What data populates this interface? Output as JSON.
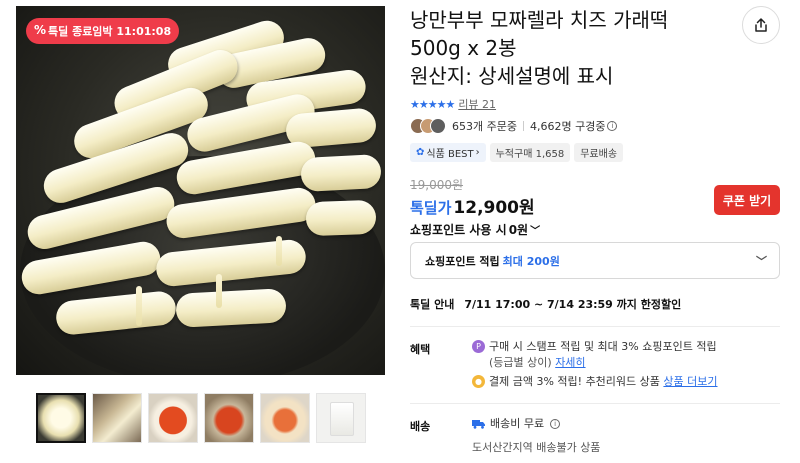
{
  "gallery": {
    "badge_text": "특딜 종료임박 11:01:08",
    "badge_icon": "percent-icon",
    "thumbnails": [
      "thumb-1",
      "thumb-2",
      "thumb-3",
      "thumb-4",
      "thumb-5",
      "thumb-6"
    ]
  },
  "product": {
    "title_line1": "낭만부부 모짜렐라 치즈 가래떡",
    "title_line2": "500g x 2봉",
    "title_line3": "원산지: 상세설명에 표시",
    "stars": "★★★★★",
    "review_label": "리뷰 21",
    "order_count": "653개 주문중",
    "view_count": "4,662명 구경중",
    "tags": {
      "best": "식품 BEST",
      "cumulative": "누적구매 1,658",
      "free_shipping": "무료배송"
    }
  },
  "price": {
    "original": "19,000원",
    "label": "톡딜가",
    "value": "12,900원",
    "coupon_button": "쿠폰 받기"
  },
  "points": {
    "use_label": "쇼핑포인트 사용 시",
    "use_value": "0원",
    "earn_label": "쇼핑포인트 적립",
    "earn_max": "최대 200원"
  },
  "sale_info": {
    "label": "톡딜 안내",
    "period": "7/11 17:00 ~ 7/14 23:59 까지 한정할인"
  },
  "benefits": {
    "label": "혜택",
    "line1": "구매 시 스탬프 적립 및 최대 3% 쇼핑포인트 적립",
    "line1_sub": "(등급별 상이)",
    "line1_link": "자세히",
    "line2": "결제 금액 3% 적립! 추천리워드 상품",
    "line2_link": "상품 더보기"
  },
  "shipping": {
    "label": "배송",
    "fee": "배송비 무료",
    "note": "도서산간지역 배송불가 상품"
  },
  "colors": {
    "accent_blue": "#2c6fe8",
    "coupon_red": "#e4342d",
    "badge_red": "#ef3c4a"
  }
}
